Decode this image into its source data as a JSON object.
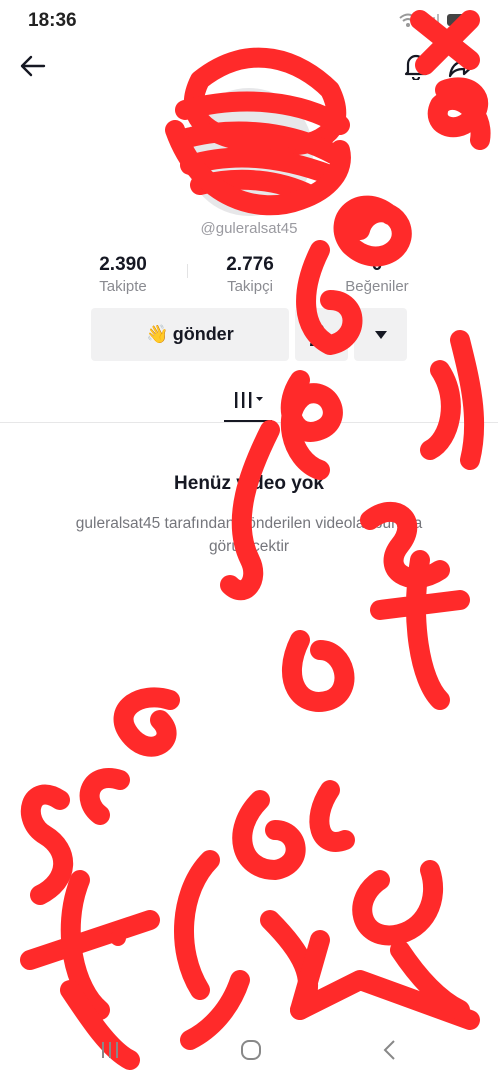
{
  "status": {
    "time": "18:36"
  },
  "profile": {
    "username": "@guleralsat45",
    "stats": [
      {
        "value": "2.390",
        "label": "Takipte"
      },
      {
        "value": "2.776",
        "label": "Takipçi"
      },
      {
        "value": "0",
        "label": "Beğeniler"
      }
    ],
    "send_label": "gönder",
    "send_emoji": "👋"
  },
  "empty": {
    "title": "Henüz video yok",
    "description": "guleralsat45 tarafından gönderilen videolar burada görülecektir"
  },
  "colors": {
    "scribble": "#ff2a2a",
    "text": "#161823",
    "muted": "#8a8b91"
  }
}
